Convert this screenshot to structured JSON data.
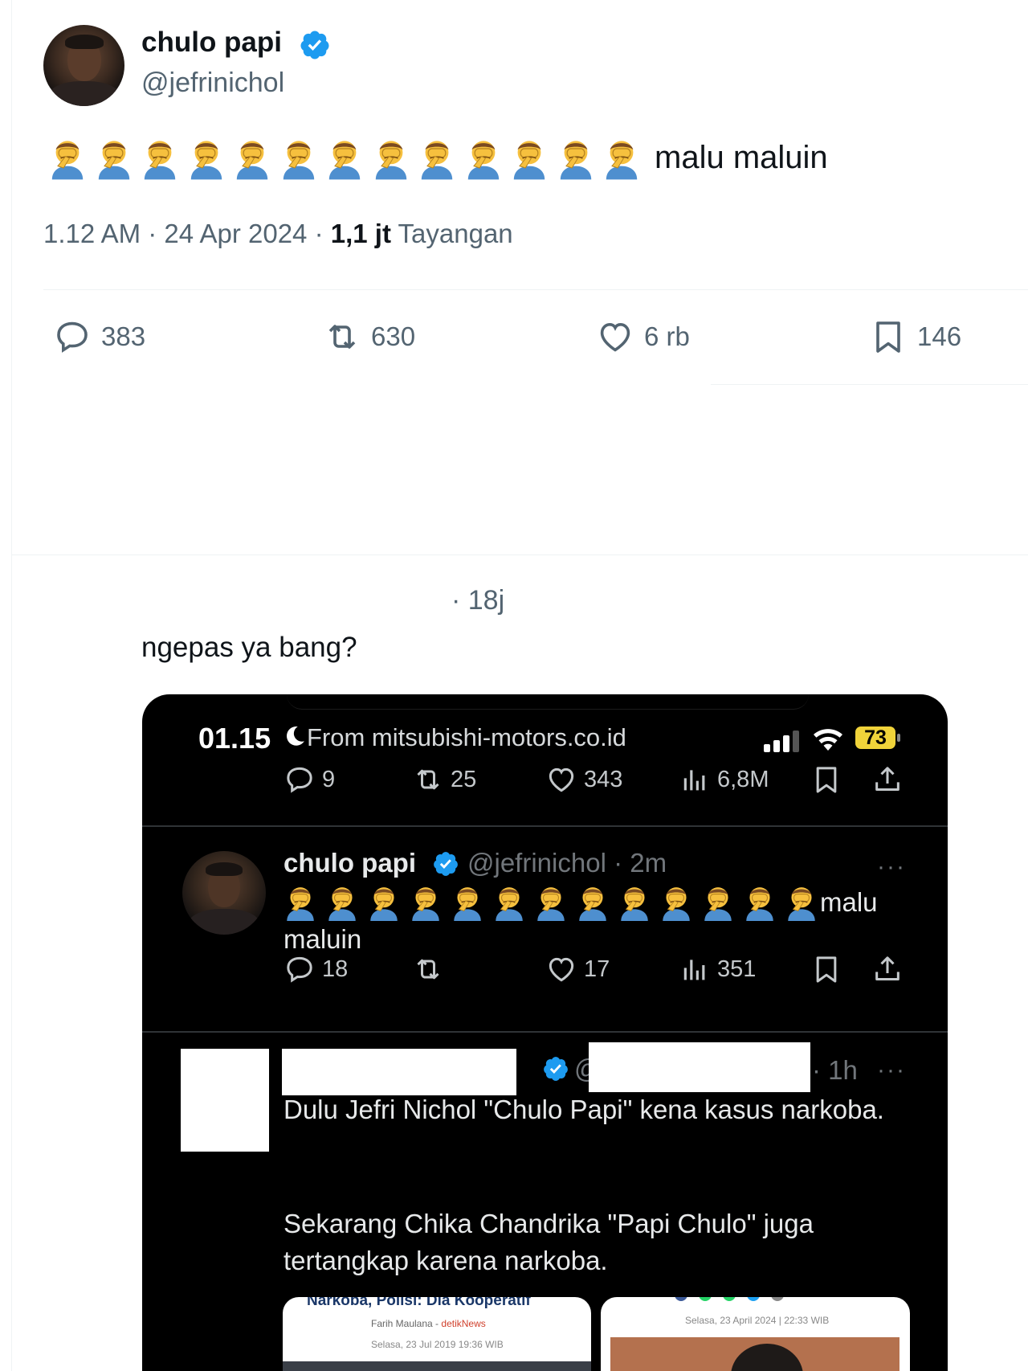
{
  "tweet": {
    "author_name": "chulo papi",
    "author_handle": "@jefrinichol",
    "emoji_count": 13,
    "text": "malu maluin",
    "time": "1.12 AM",
    "date_sep": "·",
    "date": "24 Apr 2024",
    "views_sep": "·",
    "views_count": "1,1 jt",
    "views_label": "Tayangan",
    "stats": {
      "replies": "383",
      "retweets": "630",
      "likes": "6 rb",
      "bookmarks": "146"
    }
  },
  "reply": {
    "time": "· 18j",
    "text": "ngepas ya bang?"
  },
  "screenshot": {
    "status_time": "01.15",
    "status_from": "From mitsubishi-motors.co.id",
    "battery": "73",
    "top_actions": {
      "replies": "9",
      "retweets": "25",
      "likes": "343",
      "views": "6,8M"
    },
    "post": {
      "author_name": "chulo papi",
      "meta": "@jefrinichol · 2m",
      "more": "···",
      "emoji_count": 13,
      "text_line1": "malu",
      "text_line2": "maluin",
      "actions": {
        "replies": "18",
        "likes": "17",
        "views": "351"
      }
    },
    "quoted": {
      "at": "@",
      "time": "· 1h",
      "more": "···",
      "paragraph1": "Dulu Jefri Nichol \"Chulo Papi\" kena kasus narkoba.",
      "paragraph2": "Sekarang Chika Chandrika \"Papi Chulo\" juga tertangkap karena narkoba."
    },
    "cards": {
      "card1_headline": "Narkoba, Polisi: Dia Kooperatif",
      "card1_author": "Farih Maulana",
      "card1_source": "detikNews",
      "card1_date": "Selasa, 23 Jul 2019 19:36 WIB",
      "card2_date": "Selasa, 23 April 2024 | 22:33 WIB"
    }
  },
  "colors": {
    "verified_blue": "#1d9bf0",
    "text_primary": "#0f1419",
    "text_secondary": "#536471",
    "battery_yellow": "#f0d33a"
  },
  "icons": [
    "verified-badge-icon",
    "reply-icon",
    "retweet-icon",
    "like-icon",
    "bookmark-icon",
    "views-icon",
    "share-icon",
    "face-palm-emoji",
    "moon-icon",
    "signal-icon",
    "wifi-icon",
    "battery-icon"
  ]
}
